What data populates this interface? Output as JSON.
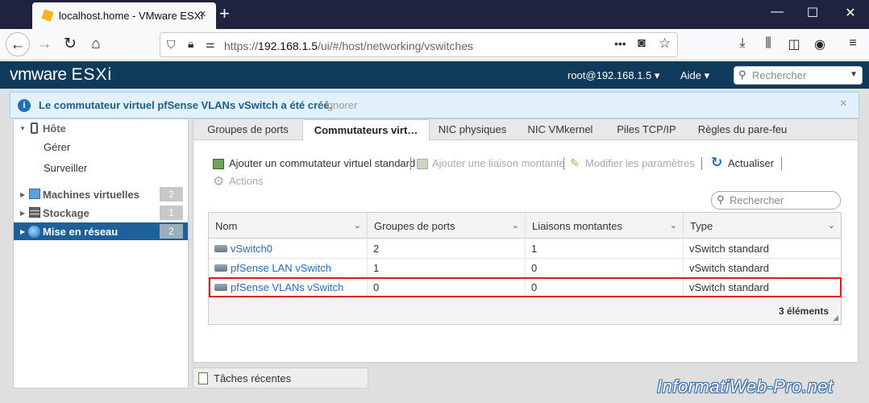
{
  "browser": {
    "tab_title": "localhost.home - VMware ESXi",
    "tab_close": "×",
    "new_tab": "+",
    "url_prefix": "https://",
    "url_host": "192.168.1.5",
    "url_path": "/ui/#/host/networking/vswitches",
    "url_more": "•••"
  },
  "esxi": {
    "logo_vm": "vmware",
    "logo_product": "ESXi",
    "user": "root@192.168.1.5 ▾",
    "help": "Aide ▾",
    "search_placeholder": "Rechercher"
  },
  "notification": {
    "message": "Le commutateur virtuel pfSense VLANs vSwitch a été créé.",
    "dismiss": "- ignorer",
    "close": "×"
  },
  "sidebar": {
    "host_label": "Hôte",
    "manage": "Gérer",
    "monitor": "Surveiller",
    "items": [
      {
        "label": "Machines virtuelles",
        "count": "2"
      },
      {
        "label": "Stockage",
        "count": "1"
      },
      {
        "label": "Mise en réseau",
        "count": "2"
      }
    ]
  },
  "tabs": [
    "Groupes de ports",
    "Commutateurs virt…",
    "NIC physiques",
    "NIC VMkernel",
    "Piles TCP/IP",
    "Règles du pare-feu"
  ],
  "toolbar": {
    "add_vswitch": "Ajouter un commutateur virtuel standard",
    "add_uplink": "Ajouter une liaison montante",
    "edit_settings": "Modifier les paramètres",
    "refresh": "Actualiser",
    "actions": "Actions",
    "search_placeholder": "Rechercher"
  },
  "grid": {
    "columns": [
      "Nom",
      "Groupes de ports",
      "Liaisons montantes",
      "Type"
    ],
    "rows": [
      {
        "name": "vSwitch0",
        "port_groups": "2",
        "uplinks": "1",
        "type": "vSwitch standard"
      },
      {
        "name": "pfSense LAN vSwitch",
        "port_groups": "1",
        "uplinks": "0",
        "type": "vSwitch standard"
      },
      {
        "name": "pfSense VLANs vSwitch",
        "port_groups": "0",
        "uplinks": "0",
        "type": "vSwitch standard"
      }
    ],
    "footer": "3 éléments"
  },
  "recent_tasks": "Tâches récentes",
  "watermark": "InformatiWeb-Pro.net",
  "colors": {
    "esxi_header": "#0f3a5a",
    "selected": "#1e6099",
    "link": "#2a6ab1",
    "highlight": "#e0191f"
  }
}
